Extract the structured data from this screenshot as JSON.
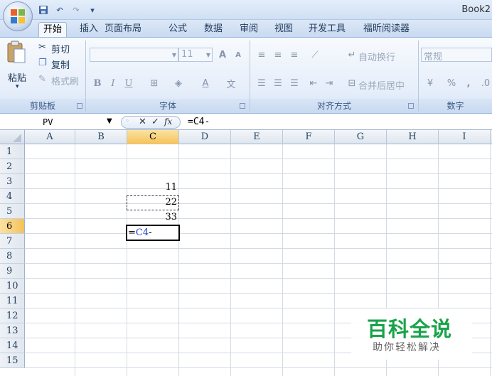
{
  "window": {
    "title": "Book2"
  },
  "quick_access": {
    "redo_label": "↷",
    "undo_label": "↶",
    "customize_label": "▾"
  },
  "tabs": [
    "开始",
    "插入",
    "页面布局",
    "公式",
    "数据",
    "审阅",
    "视图",
    "开发工具",
    "福昕阅读器"
  ],
  "ribbon": {
    "clipboard": {
      "paste": "粘贴",
      "cut": "剪切",
      "copy": "复制",
      "format_painter": "格式刷",
      "label": "剪贴板"
    },
    "font": {
      "size": "11",
      "label": "字体",
      "bold": "B",
      "italic": "I",
      "underline": "U",
      "grow": "A",
      "shrink": "A"
    },
    "alignment": {
      "wrap": "自动换行",
      "merge": "合并后居中",
      "label": "对齐方式"
    },
    "number": {
      "format": "常规",
      "percent": "%",
      "comma": ",",
      "label": "数字"
    }
  },
  "formula_bar": {
    "name_box": "PV",
    "cancel": "✕",
    "enter": "✓",
    "fx": "fx",
    "formula": "=C4-"
  },
  "sheet": {
    "columns": [
      "A",
      "B",
      "C",
      "D",
      "E",
      "F",
      "G",
      "H",
      "I"
    ],
    "rows": [
      "1",
      "2",
      "3",
      "4",
      "5",
      "6",
      "7",
      "8",
      "9",
      "10",
      "11",
      "12",
      "13",
      "14",
      "15"
    ],
    "selected_column": "C",
    "selected_row": "6",
    "cells": {
      "C3": "11",
      "C4": "22",
      "C5": "33"
    },
    "edit": {
      "prefix": "=",
      "ref": "C4",
      "suffix": "-"
    }
  },
  "watermark": {
    "title": "百科全说",
    "subtitle": "助你轻松解决"
  },
  "colors": {
    "accent": "#f4c25a",
    "ribbon": "#e6eefa",
    "watermark": "#1aa34a",
    "ref": "#1f3fcc"
  }
}
